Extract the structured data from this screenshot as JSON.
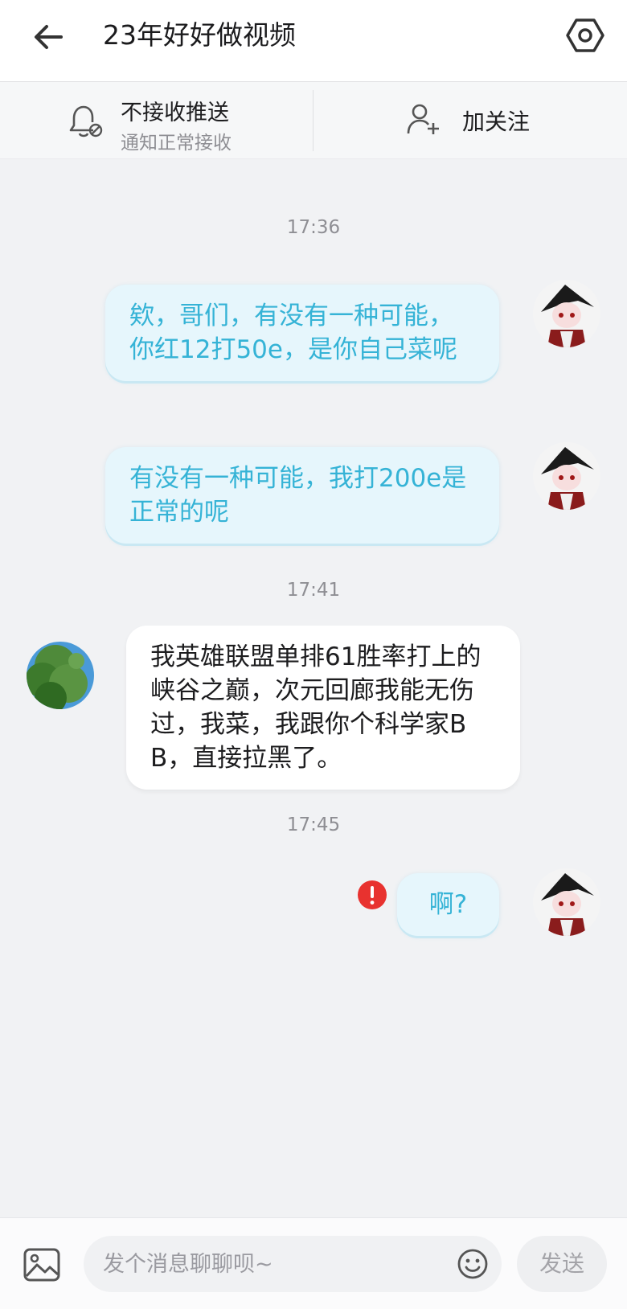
{
  "header": {
    "title": "23年好好做视频",
    "back_icon": "arrow-left-icon",
    "settings_icon": "hexagon-settings-icon"
  },
  "actions": {
    "push_title": "不接收推送",
    "push_subtitle": "通知正常接收",
    "follow_label": "加关注"
  },
  "messages": [
    {
      "time": "17:36"
    },
    {
      "from": "me",
      "text": "欸，哥们，有没有一种可能，你红12打50e，是你自己菜呢"
    },
    {
      "from": "me",
      "text": "有没有一种可能，我打200e是正常的呢"
    },
    {
      "time": "17:41"
    },
    {
      "from": "them",
      "text": "我英雄联盟单排61胜率打上的峡谷之巅，次元回廊我能无伤过，我菜，我跟你个科学家BB，直接拉黑了。"
    },
    {
      "time": "17:45"
    },
    {
      "from": "me",
      "text": "啊?",
      "status": "failed"
    }
  ],
  "input": {
    "placeholder": "发个消息聊聊呗~",
    "send_label": "发送"
  },
  "colors": {
    "my_bubble_bg": "#e6f6fc",
    "my_bubble_text": "#35b3d6",
    "error_red": "#e8322f"
  }
}
